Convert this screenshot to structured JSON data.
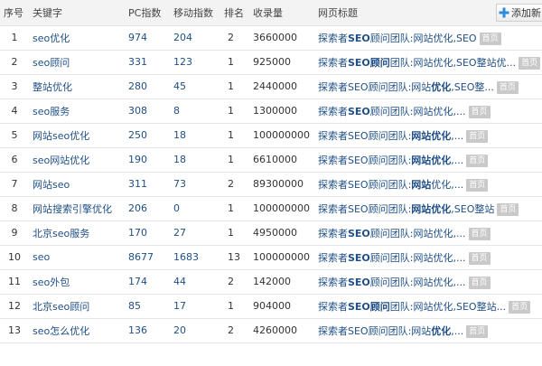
{
  "header": {
    "col_index": "序号",
    "col_keyword": "关键字",
    "col_pc": "PC指数",
    "col_mobile": "移动指数",
    "col_rank": "排名",
    "col_indexed": "收录量",
    "col_title": "网页标题",
    "add_button": "添加新"
  },
  "home_badge": "首页",
  "colors": {
    "link": "#1f4f86",
    "header_bg": "#f3f3f3",
    "badge_bg": "#c9c9c9",
    "plus_icon": "#2e8bd8"
  },
  "rows": [
    {
      "index": "1",
      "keyword": "seo优化",
      "pc": "974",
      "mobile": "204",
      "rank": "2",
      "indexed": "3660000",
      "title_plain": "探索者",
      "title_bold": "SEO",
      "title_rest": "顾问团队:网站优化,SEO"
    },
    {
      "index": "2",
      "keyword": "seo顾问",
      "pc": "331",
      "mobile": "123",
      "rank": "1",
      "indexed": "925000",
      "title_plain": "探索者",
      "title_bold": "SEO顾问",
      "title_rest": "团队:网站优化,SEO整站优..."
    },
    {
      "index": "3",
      "keyword": "整站优化",
      "pc": "280",
      "mobile": "45",
      "rank": "1",
      "indexed": "2440000",
      "title_plain": "探索者SEO顾问团队:网站",
      "title_bold": "优化",
      "title_rest": ",SEO整..."
    },
    {
      "index": "4",
      "keyword": "seo服务",
      "pc": "308",
      "mobile": "8",
      "rank": "1",
      "indexed": "1300000",
      "title_plain": "探索者",
      "title_bold": "SEO",
      "title_rest": "顾问团队:网站优化,..."
    },
    {
      "index": "5",
      "keyword": "网站seo优化",
      "pc": "250",
      "mobile": "18",
      "rank": "1",
      "indexed": "100000000",
      "title_plain": "探索者SEO顾问团队:",
      "title_bold": "网站优化",
      "title_rest": ",..."
    },
    {
      "index": "6",
      "keyword": "seo网站优化",
      "pc": "190",
      "mobile": "18",
      "rank": "1",
      "indexed": "6610000",
      "title_plain": "探索者SEO顾问团队:",
      "title_bold": "网站优化",
      "title_rest": ",..."
    },
    {
      "index": "7",
      "keyword": "网站seo",
      "pc": "311",
      "mobile": "73",
      "rank": "2",
      "indexed": "89300000",
      "title_plain": "探索者SEO顾问团队:",
      "title_bold": "网站",
      "title_rest": "优化,..."
    },
    {
      "index": "8",
      "keyword": "网站搜索引擎优化",
      "pc": "206",
      "mobile": "0",
      "rank": "1",
      "indexed": "100000000",
      "title_plain": "探索者SEO顾问团队:",
      "title_bold": "网站优化",
      "title_rest": ",SEO整站"
    },
    {
      "index": "9",
      "keyword": "北京seo服务",
      "pc": "170",
      "mobile": "27",
      "rank": "1",
      "indexed": "4950000",
      "title_plain": "探索者",
      "title_bold": "SEO",
      "title_rest": "顾问团队:网站优化,..."
    },
    {
      "index": "10",
      "keyword": "seo",
      "pc": "8677",
      "mobile": "1683",
      "rank": "13",
      "indexed": "100000000",
      "title_plain": "探索者",
      "title_bold": "SEO",
      "title_rest": "顾问团队:网站优化,..."
    },
    {
      "index": "11",
      "keyword": "seo外包",
      "pc": "174",
      "mobile": "44",
      "rank": "2",
      "indexed": "142000",
      "title_plain": "探索者",
      "title_bold": "SEO",
      "title_rest": "顾问团队:网站优化,..."
    },
    {
      "index": "12",
      "keyword": "北京seo顾问",
      "pc": "85",
      "mobile": "17",
      "rank": "1",
      "indexed": "904000",
      "title_plain": "探索者",
      "title_bold": "SEO顾问",
      "title_rest": "团队:网站优化,SEO整站..."
    },
    {
      "index": "13",
      "keyword": "seo怎么优化",
      "pc": "136",
      "mobile": "20",
      "rank": "2",
      "indexed": "4260000",
      "title_plain": "探索者SEO顾问团队:网站",
      "title_bold": "优化",
      "title_rest": ",..."
    }
  ]
}
